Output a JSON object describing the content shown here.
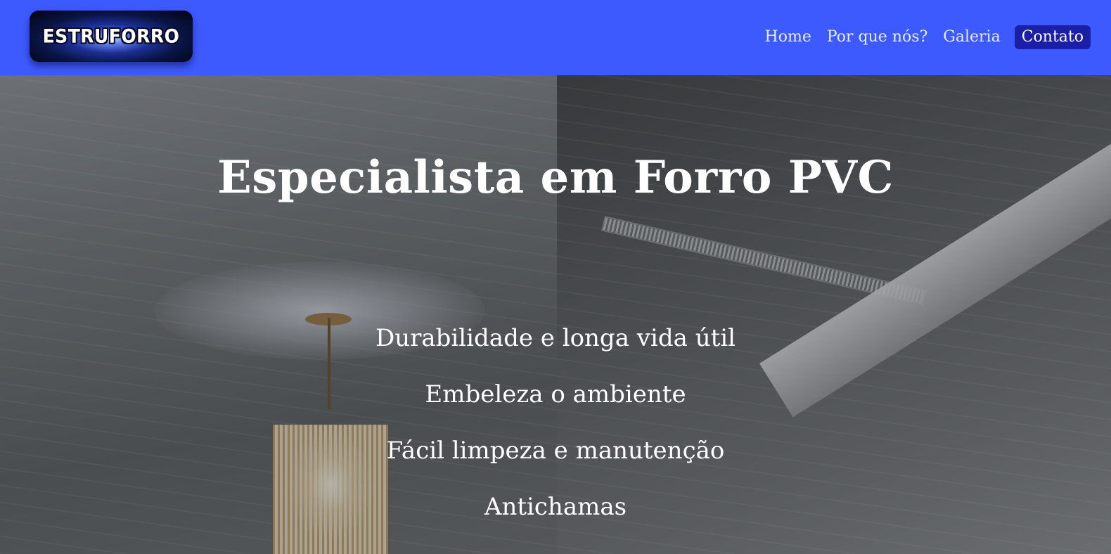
{
  "brand": {
    "logo_text": "ESTRUFORRO"
  },
  "nav": {
    "items": [
      {
        "label": "Home"
      },
      {
        "label": "Por que nós?"
      },
      {
        "label": "Galeria"
      },
      {
        "label": "Contato",
        "active": true
      }
    ]
  },
  "hero": {
    "title": "Especialista em Forro PVC",
    "features": [
      "Durabilidade e longa vida útil",
      "Embeleza o ambiente",
      "Fácil limpeza e manutenção",
      "Antichamas"
    ]
  },
  "colors": {
    "navbar": "#3d5afe",
    "active_nav": "#1a1fa6",
    "text": "#ffffff"
  }
}
